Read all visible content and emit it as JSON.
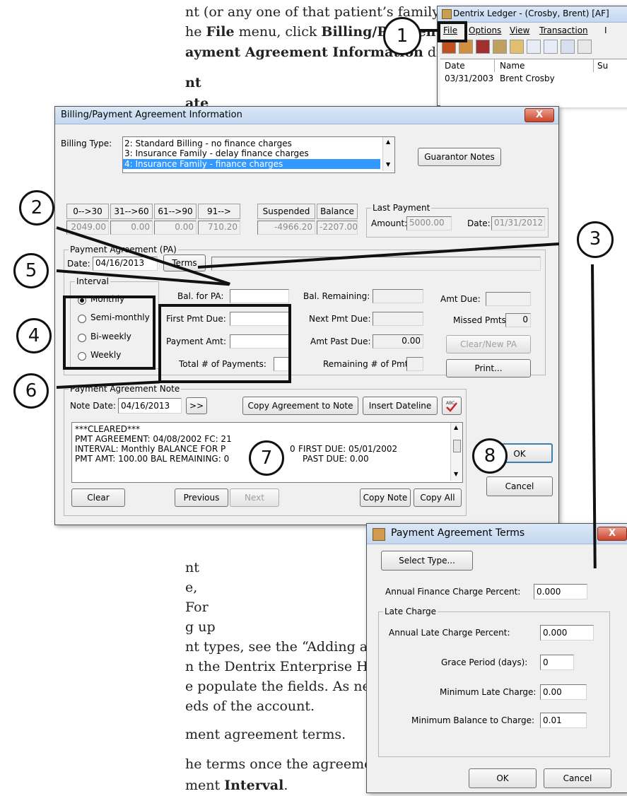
{
  "doc": {
    "l1": "nt (or any one of that patient’s family",
    "l2a": "he ",
    "l2b": "File",
    "l2c": " menu, click ",
    "l2d": "Billing/Payment",
    "l3": "ayment Agreement Information",
    "l3b": " dialog box",
    "l4": "nt",
    "l5": "ate",
    "l6": "nt",
    "l7": "e,",
    "l8": "For",
    "l9": "g up",
    "l10": "nt types, see the “Adding and editing payment",
    "l11": "n the Dentrix Enterprise Help. The terms",
    "l12": "e populate the fields. As needed, modify the",
    "l13": "eds of the account.",
    "l14": "ment agreement terms.",
    "l15": "he terms once the agreement has been saved.",
    "l16a": "ment ",
    "l16b": "Interval",
    "l16c": "."
  },
  "ledger": {
    "title": "Dentrix Ledger - (Crosby, Brent) [AF]",
    "menu": [
      "File",
      "Options",
      "View",
      "Transaction",
      "I"
    ],
    "col_date": "Date",
    "col_name": "Name",
    "col_su": "Su",
    "row1_date": "03/31/2003",
    "row1_name": "Brent Crosby"
  },
  "billing": {
    "title": "Billing/Payment Agreement Information",
    "close": "X",
    "billing_type_label": "Billing Type:",
    "billing_options": [
      "2: Standard Billing - no finance charges",
      "3: Insurance Family - delay finance charges",
      "4: Insurance Family - finance charges"
    ],
    "guarantor_notes": "Guarantor Notes",
    "aging_headers": [
      "0-->30",
      "31-->60",
      "61-->90",
      "91-->",
      "Suspended",
      "Balance"
    ],
    "aging_values": [
      "2049.00",
      "0.00",
      "0.00",
      "710.20",
      "-4966.20",
      "-2207.00"
    ],
    "last_payment": "Last Payment",
    "amount_label": "Amount:",
    "amount_value": "5000.00",
    "date_label": "Date:",
    "date_value": "01/31/2012",
    "pa_group": "Payment Agreement (PA)",
    "pa_date_label": "Date:",
    "pa_date_value": "04/16/2013",
    "terms": "Terms",
    "interval": "Interval",
    "intervals": [
      "Monthly",
      "Semi-monthly",
      "Bi-weekly",
      "Weekly"
    ],
    "bal_for_pa": "Bal. for PA:",
    "first_pmt_due": "First Pmt Due:",
    "payment_amt": "Payment Amt:",
    "total_payments": "Total # of Payments:",
    "bal_remaining": "Bal. Remaining:",
    "next_pmt_due": "Next Pmt Due:",
    "amt_past_due": "Amt Past Due:",
    "amt_past_due_value": "0.00",
    "remaining_pmts": "Remaining # of Pmts:",
    "amt_due": "Amt Due:",
    "missed_pmts": "Missed Pmts:",
    "missed_pmts_value": "0",
    "clear_new_pa": "Clear/New PA",
    "print": "Print...",
    "note_group": "Payment Agreement Note",
    "note_date_label": "Note Date:",
    "note_date_value": "04/16/2013",
    "note_next": ">>",
    "copy_agreement": "Copy Agreement to Note",
    "insert_dateline": "Insert Dateline",
    "note_lines": [
      "***CLEARED***",
      "PMT AGREEMENT: 04/08/2002  FC: 21",
      "INTERVAL: Monthly  BALANCE FOR P",
      "PMT AMT: 100.00  BAL REMAINING: 0"
    ],
    "note_lines_right": [
      "",
      "",
      "FIRST DUE: 05/01/2002",
      "PAST DUE: 0.00"
    ],
    "note_frag": "0",
    "clear": "Clear",
    "previous": "Previous",
    "next": "Next",
    "copy_note": "Copy Note",
    "copy_all": "Copy All",
    "ok": "OK",
    "cancel": "Cancel"
  },
  "terms_dialog": {
    "title": "Payment Agreement Terms",
    "close": "X",
    "select_type": "Select Type...",
    "annual_finance": "Annual Finance Charge Percent:",
    "annual_finance_value": "0.000",
    "late_charge": "Late Charge",
    "annual_late": "Annual Late Charge Percent:",
    "annual_late_value": "0.000",
    "grace": "Grace Period (days):",
    "grace_value": "0",
    "min_late": "Minimum Late Charge:",
    "min_late_value": "0.00",
    "min_balance": "Minimum Balance to Charge:",
    "min_balance_value": "0.01",
    "ok": "OK",
    "cancel": "Cancel"
  },
  "callouts": [
    "1",
    "2",
    "3",
    "4",
    "5",
    "6",
    "7",
    "8"
  ],
  "colors": {
    "selection": "#3399ff",
    "close_button": "#c9462b",
    "title_bar": "#c3d7ef"
  }
}
